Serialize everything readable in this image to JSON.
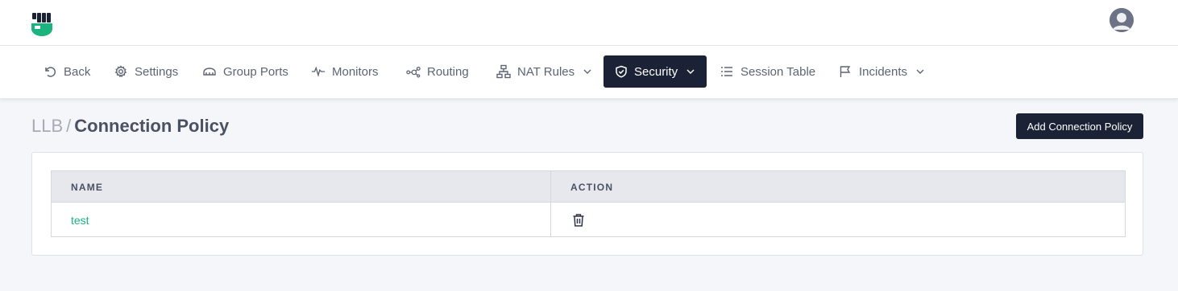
{
  "header": {
    "logo_icon": "brand-fist-shield-logo",
    "avatar_icon": "user-avatar-icon",
    "brand_color": "#1bb37e"
  },
  "nav": {
    "items": [
      {
        "label": "Back",
        "icon": "undo-arrow-icon"
      },
      {
        "label": "Settings",
        "icon": "gear-icon"
      },
      {
        "label": "Group Ports",
        "icon": "port-hub-icon"
      },
      {
        "label": "Monitors",
        "icon": "pulse-icon"
      },
      {
        "label": "Routing",
        "icon": "routing-nodes-icon"
      },
      {
        "label": "NAT Rules",
        "icon": "network-tree-icon",
        "has_dropdown": true
      },
      {
        "label": "Security",
        "icon": "shield-check-icon",
        "has_dropdown": true,
        "active": true
      },
      {
        "label": "Session Table",
        "icon": "list-icon"
      },
      {
        "label": "Incidents",
        "icon": "flag-icon",
        "has_dropdown": true
      }
    ],
    "active_color": "#1b2235"
  },
  "breadcrumb": {
    "root": "LLB",
    "separator": "/",
    "current": "Connection Policy"
  },
  "actions": {
    "add_label": "Add Connection Policy"
  },
  "table": {
    "columns": [
      "NAME",
      "ACTION"
    ],
    "rows": [
      {
        "name": "test",
        "action_icon": "trash-icon"
      }
    ]
  }
}
